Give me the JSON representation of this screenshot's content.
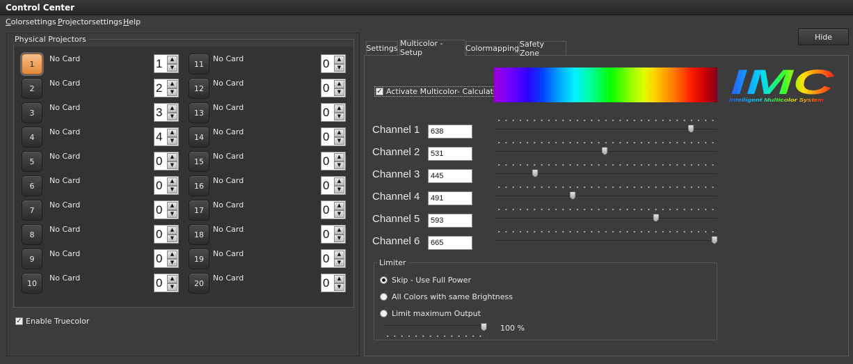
{
  "window": {
    "title": "Control Center"
  },
  "menu": [
    "Colorsettings",
    "Projectorsettings",
    "Help"
  ],
  "projectors": {
    "group_title": "Physical Projectors",
    "items": [
      {
        "number": "1",
        "label": "No Card",
        "value": "1",
        "active": true
      },
      {
        "number": "2",
        "label": "No Card",
        "value": "2"
      },
      {
        "number": "3",
        "label": "No Card",
        "value": "3"
      },
      {
        "number": "4",
        "label": "No Card",
        "value": "4"
      },
      {
        "number": "5",
        "label": "No Card",
        "value": "0"
      },
      {
        "number": "6",
        "label": "No Card",
        "value": "0"
      },
      {
        "number": "7",
        "label": "No Card",
        "value": "0"
      },
      {
        "number": "8",
        "label": "No Card",
        "value": "0"
      },
      {
        "number": "9",
        "label": "No Card",
        "value": "0"
      },
      {
        "number": "10",
        "label": "No Card",
        "value": "0"
      },
      {
        "number": "11",
        "label": "No Card",
        "value": "0"
      },
      {
        "number": "12",
        "label": "No Card",
        "value": "0"
      },
      {
        "number": "13",
        "label": "No Card",
        "value": "0"
      },
      {
        "number": "14",
        "label": "No Card",
        "value": "0"
      },
      {
        "number": "15",
        "label": "No Card",
        "value": "0"
      },
      {
        "number": "16",
        "label": "No Card",
        "value": "0"
      },
      {
        "number": "17",
        "label": "No Card",
        "value": "0"
      },
      {
        "number": "18",
        "label": "No Card",
        "value": "0"
      },
      {
        "number": "19",
        "label": "No Card",
        "value": "0"
      },
      {
        "number": "20",
        "label": "No Card",
        "value": "0"
      }
    ]
  },
  "truecolor": {
    "label": "Enable Truecolor",
    "checked": true
  },
  "hide_button": "Hide",
  "tabs": [
    {
      "label": "Settings"
    },
    {
      "label": "Multicolor - Setup",
      "active": true
    },
    {
      "label": "Colormapping"
    },
    {
      "label": "Safety Zone"
    }
  ],
  "multicolor": {
    "activate_label": "Activate Multicolor- Calculation",
    "activate_checked": true,
    "logo_text": "IMC",
    "logo_subtitle": "Intelligent Multicolor System",
    "channels": [
      {
        "label": "Channel 1",
        "value": "638",
        "slider": 0.885
      },
      {
        "label": "Channel 2",
        "value": "531",
        "slider": 0.495
      },
      {
        "label": "Channel 3",
        "value": "445",
        "slider": 0.18
      },
      {
        "label": "Channel 4",
        "value": "491",
        "slider": 0.35
      },
      {
        "label": "Channel 5",
        "value": "593",
        "slider": 0.725
      },
      {
        "label": "Channel 6",
        "value": "665",
        "slider": 0.99
      }
    ]
  },
  "limiter": {
    "title": "Limiter",
    "options": [
      {
        "label": "Skip - Use Full Power",
        "selected": true
      },
      {
        "label": "All Colors with same Brightness"
      },
      {
        "label": "Limit maximum Output"
      }
    ],
    "output_value": "100 %",
    "output_level": 1.0
  }
}
